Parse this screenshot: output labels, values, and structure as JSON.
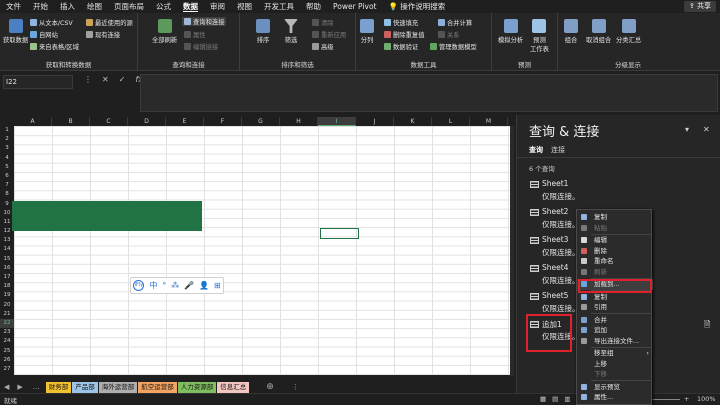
{
  "menu": [
    "文件",
    "开始",
    "插入",
    "绘图",
    "页面布局",
    "公式",
    "数据",
    "审阅",
    "视图",
    "开发工具",
    "帮助",
    "Power Pivot",
    "操作说明搜索"
  ],
  "share_label": "共享",
  "ribbon": {
    "get_data": "获取数据",
    "from_text": "从文本/CSV",
    "from_web": "自网站",
    "from_table": "来自表格/区域",
    "recent": "最近使用的源",
    "existing": "现有连接",
    "group1": "获取和转换数据",
    "refresh_all": "全部刷新",
    "queries_conn": "查询和连接",
    "properties": "属性",
    "edit_links": "编辑链接",
    "group2": "查询和连接",
    "sort_az": "↑",
    "sort": "排序",
    "filter": "筛选",
    "clear": "清除",
    "reapply": "重新应用",
    "advanced": "高级",
    "group3": "排序和筛选",
    "split": "分列",
    "flash_fill": "快速填充",
    "remove_dup": "删除重复值",
    "validation": "数据验证",
    "consolidate": "合并计算",
    "relationships": "关系",
    "manage_model": "管理数据模型",
    "group4": "数据工具",
    "whatif": "模拟分析",
    "forecast": "预测\n工作表",
    "group5": "预测",
    "group_btn": "组合",
    "ungroup": "取消组合",
    "subtotal": "分类汇总",
    "group6": "分级显示"
  },
  "namebox": "I22",
  "fx_icons": [
    "⋮",
    "✕",
    "✓",
    "fx"
  ],
  "columns": [
    "A",
    "B",
    "C",
    "D",
    "E",
    "F",
    "G",
    "H",
    "I",
    "J",
    "K",
    "L",
    "M"
  ],
  "rows": [
    "1",
    "2",
    "3",
    "4",
    "5",
    "6",
    "7",
    "8",
    "9",
    "10",
    "11",
    "12",
    "13",
    "14",
    "15",
    "16",
    "17",
    "18",
    "19",
    "20",
    "21",
    "22",
    "23",
    "24",
    "25",
    "26",
    "27"
  ],
  "ime": [
    "中",
    "°",
    "⁂",
    "🎤",
    "👤",
    "⊞"
  ],
  "sheet_tabs": [
    {
      "label": "财务部",
      "color": "#f2c12e"
    },
    {
      "label": "产品部",
      "color": "#9dc3e6"
    },
    {
      "label": "海外运营部",
      "color": "#aeaeae"
    },
    {
      "label": "航空运营部",
      "color": "#f4a460"
    },
    {
      "label": "人力资源部",
      "color": "#7fbf5f"
    },
    {
      "label": "信息汇总",
      "color": "#f4c6c0"
    }
  ],
  "status": {
    "zoom": "100%"
  },
  "pane": {
    "title": "查询 & 连接",
    "tabs": [
      "查询",
      "连接"
    ],
    "count": "6 个查询",
    "queries": [
      {
        "name": "Sheet1",
        "status": "仅限连接。"
      },
      {
        "name": "Sheet2",
        "status": "仅限连接。"
      },
      {
        "name": "Sheet3",
        "status": "仅限连接。"
      },
      {
        "name": "Sheet4",
        "status": "仅限连接。"
      },
      {
        "name": "Sheet5",
        "status": "仅限连接。"
      },
      {
        "name": "追加1",
        "status": "仅限连接。"
      }
    ]
  },
  "context_menu": [
    "复制",
    "粘贴",
    "编辑",
    "删除",
    "重命名",
    "刷新",
    "加载到...",
    "复制",
    "引用",
    "合并",
    "追加",
    "导出连接文件...",
    "移至组",
    "上移",
    "下移",
    "显示预览",
    "属性..."
  ]
}
